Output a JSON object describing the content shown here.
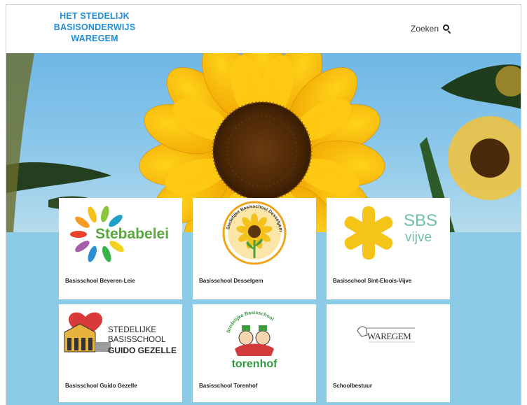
{
  "header": {
    "logo_lines": [
      "HET STEDELIJK",
      "BASISONDERWIJS",
      "WAREGEM"
    ],
    "search_label": "Zoeken",
    "search_icon": "search-icon",
    "brand_color": "#1f8ed6"
  },
  "cards": [
    {
      "label": "Basisschool Beveren-Leie",
      "logo_text": "Stebabelei"
    },
    {
      "label": "Basisschool Desselgem",
      "logo_text": "Stedelijke Basisschool Desselgem"
    },
    {
      "label": "Basisschool Sint-Eloois-Vijve",
      "logo_text": "SBS vijve"
    },
    {
      "label": "Basisschool Guido Gezelle",
      "logo_lines": [
        "STEDELIJKE",
        "BASISSCHOOL",
        "GUIDO GEZELLE"
      ]
    },
    {
      "label": "Basisschool Torenhof",
      "logo_lines": [
        "Stedelijke Basisschool",
        "torenhof"
      ]
    },
    {
      "label": "Schoolbestuur",
      "logo_text": "WAREGEM"
    }
  ]
}
